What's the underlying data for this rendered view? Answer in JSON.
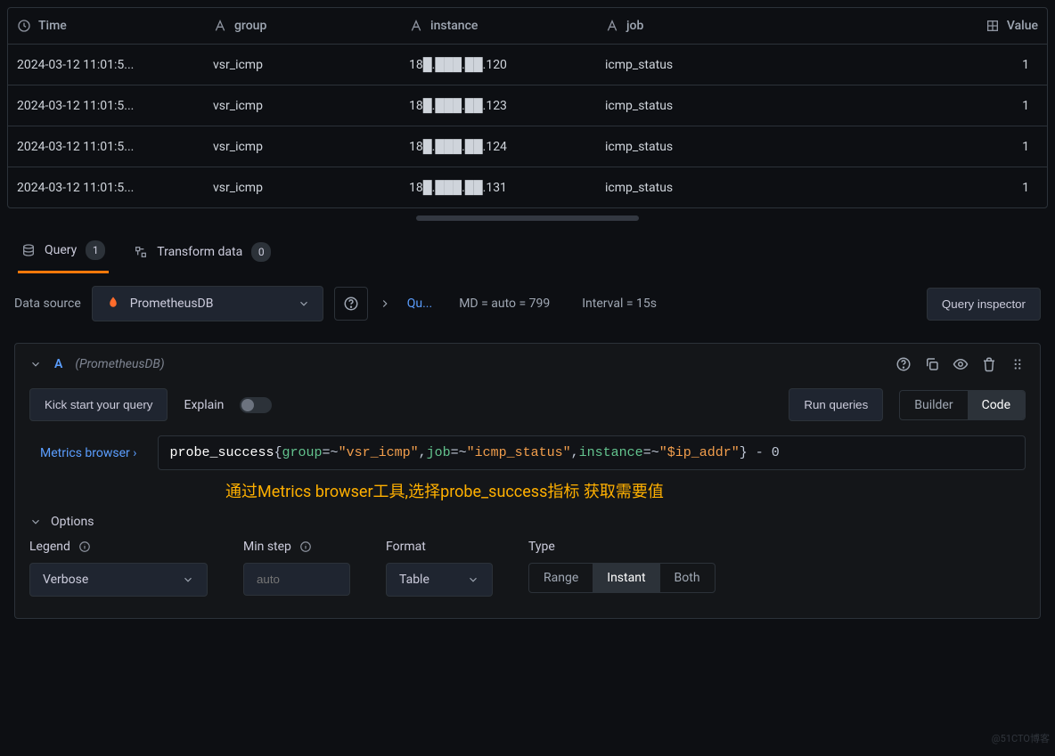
{
  "table": {
    "headers": {
      "time": "Time",
      "group": "group",
      "instance": "instance",
      "job": "job",
      "value": "Value"
    },
    "rows": [
      {
        "time": "2024-03-12 11:01:5...",
        "group": "vsr_icmp",
        "instance": "18█.███.██.120",
        "job": "icmp_status",
        "value": "1"
      },
      {
        "time": "2024-03-12 11:01:5...",
        "group": "vsr_icmp",
        "instance": "18█.███.██.123",
        "job": "icmp_status",
        "value": "1"
      },
      {
        "time": "2024-03-12 11:01:5...",
        "group": "vsr_icmp",
        "instance": "18█.███.██.124",
        "job": "icmp_status",
        "value": "1"
      },
      {
        "time": "2024-03-12 11:01:5...",
        "group": "vsr_icmp",
        "instance": "18█.███.██.131",
        "job": "icmp_status",
        "value": "1"
      }
    ]
  },
  "tabs": {
    "query": "Query",
    "query_count": "1",
    "transform": "Transform data",
    "transform_count": "0"
  },
  "toolbar": {
    "data_source_label": "Data source",
    "data_source_value": "PrometheusDB",
    "query_options": "Qu...",
    "md": "MD = auto = 799",
    "interval": "Interval = 15s",
    "inspector": "Query inspector"
  },
  "query": {
    "label": "A",
    "ds_name": "(PrometheusDB)",
    "kick_start": "Kick start your query",
    "explain": "Explain",
    "run": "Run queries",
    "builder": "Builder",
    "code": "Code",
    "metrics_browser": "Metrics browser",
    "expr": {
      "metric": "probe_success",
      "l1": "group",
      "v1": "\"vsr_icmp\"",
      "l2": "job",
      "v2": "\"icmp_status\"",
      "l3": "instance",
      "v3": "\"$ip_addr\"",
      "suffix": " - 0"
    },
    "annot": "通过Metrics browser工具,选择probe_success指标 获取需要值",
    "options_label": "Options",
    "legend": {
      "label": "Legend",
      "value": "Verbose"
    },
    "minstep": {
      "label": "Min step",
      "placeholder": "auto"
    },
    "format": {
      "label": "Format",
      "value": "Table"
    },
    "type": {
      "label": "Type",
      "range": "Range",
      "instant": "Instant",
      "both": "Both"
    }
  },
  "watermark": "@51CTO博客"
}
